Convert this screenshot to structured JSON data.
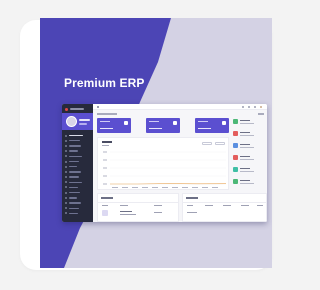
{
  "banner": {
    "title": "Premium ERP"
  },
  "colors": {
    "page_background": "#f3f3f3",
    "card_background": "#ffffff",
    "banner_background": "#d4d2e4",
    "banner_shape": "#4c45b5",
    "accent": "#5b4fd0",
    "sidebar": "#272a3c"
  },
  "mockup": {
    "kpi_cards": 3,
    "side_list_icon_colors": [
      "#4cb877",
      "#e35d5d",
      "#5b8fe0",
      "#e35d5d",
      "#3fbfa5",
      "#4cb877"
    ],
    "icons": [
      "menu-icon",
      "search-icon",
      "bell-icon",
      "settings-icon",
      "user-icon"
    ]
  }
}
